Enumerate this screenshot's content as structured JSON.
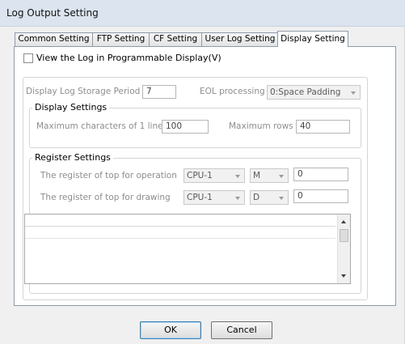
{
  "window": {
    "title": "Log Output Setting"
  },
  "tabs": [
    {
      "label": "Common Setting"
    },
    {
      "label": "FTP Setting"
    },
    {
      "label": "CF Setting"
    },
    {
      "label": "User Log Setting"
    },
    {
      "label": "Display Setting"
    }
  ],
  "view_log": {
    "label": "View the Log in Programmable Display(V)",
    "checked": false
  },
  "storage": {
    "label": "Display Log Storage Period",
    "value": "7"
  },
  "eol": {
    "label": "EOL processing",
    "value": "0:Space Padding"
  },
  "display_settings": {
    "title": "Display Settings",
    "max_chars_label": "Maximum characters of 1 line",
    "max_chars_value": "100",
    "max_rows_label": "Maximum rows",
    "max_rows_value": "40"
  },
  "register_settings": {
    "title": "Register Settings",
    "operation": {
      "label": "The register of top for operation",
      "cpu": "CPU-1",
      "device": "M",
      "value": "0"
    },
    "drawing": {
      "label": "The register of top for drawing",
      "cpu": "CPU-1",
      "device": "D",
      "value": "0"
    }
  },
  "buttons": {
    "ok": "OK",
    "cancel": "Cancel"
  }
}
